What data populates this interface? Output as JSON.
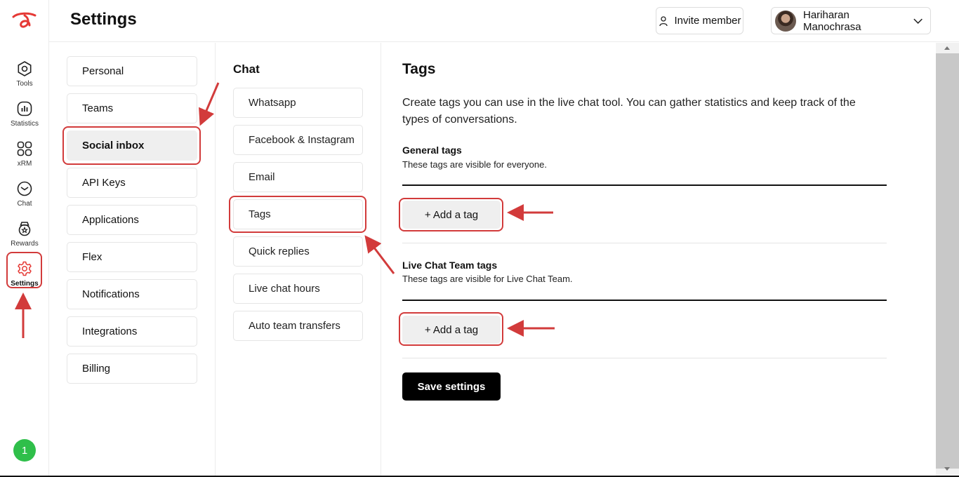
{
  "header": {
    "title": "Settings",
    "invite_label": "Invite member",
    "user_name": "Hariharan Manochrasa"
  },
  "rail": {
    "items": [
      {
        "label": "Tools",
        "icon": "tools-icon"
      },
      {
        "label": "Statistics",
        "icon": "statistics-icon"
      },
      {
        "label": "xRM",
        "icon": "grid-icon"
      },
      {
        "label": "Chat",
        "icon": "chat-icon"
      },
      {
        "label": "Rewards",
        "icon": "rewards-icon"
      },
      {
        "label": "Settings",
        "icon": "gear-icon"
      }
    ],
    "notification_count": "1"
  },
  "settings_menu": {
    "items": [
      "Personal",
      "Teams",
      "Social inbox",
      "API Keys",
      "Applications",
      "Flex",
      "Notifications",
      "Integrations",
      "Billing"
    ],
    "active": "Social inbox"
  },
  "chat_menu": {
    "title": "Chat",
    "items": [
      "Whatsapp",
      "Facebook & Instagram",
      "Email",
      "Tags",
      "Quick replies",
      "Live chat hours",
      "Auto team transfers"
    ]
  },
  "tags": {
    "title": "Tags",
    "description": "Create tags you can use in the live chat tool. You can gather statistics and keep track of the types of conversations.",
    "general_title": "General tags",
    "general_sub": "These tags are visible for everyone.",
    "add_label": "+ Add a tag",
    "team_title": "Live Chat Team tags",
    "team_sub": "These tags are visible for Live Chat Team.",
    "save_label": "Save settings"
  },
  "colors": {
    "brand": "#e53935",
    "annotation": "#d23b3b",
    "notification": "#2fbf4a"
  }
}
